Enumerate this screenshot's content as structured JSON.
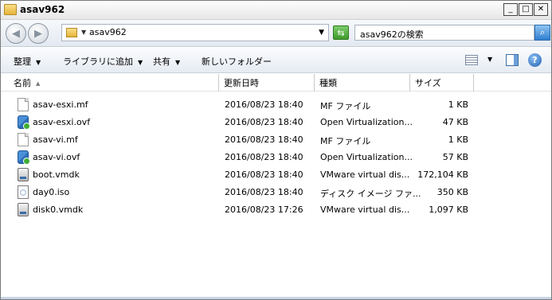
{
  "window": {
    "title": "asav962"
  },
  "address": {
    "path": "asav962"
  },
  "search": {
    "placeholder": "asav962の検索"
  },
  "toolbar": {
    "organize": "整理",
    "add_to_library": "ライブラリに追加",
    "share": "共有",
    "new_folder": "新しいフォルダー"
  },
  "columns": {
    "name": "名前",
    "date": "更新日時",
    "type": "種類",
    "size": "サイズ"
  },
  "files": [
    {
      "name": "asav-esxi.mf",
      "date": "2016/08/23 18:40",
      "type": "MF ファイル",
      "size": "1 KB",
      "icon": "document-icon"
    },
    {
      "name": "asav-esxi.ovf",
      "date": "2016/08/23 18:40",
      "type": "Open Virtualization...",
      "size": "47 KB",
      "icon": "ovf-icon"
    },
    {
      "name": "asav-vi.mf",
      "date": "2016/08/23 18:40",
      "type": "MF ファイル",
      "size": "1 KB",
      "icon": "document-icon"
    },
    {
      "name": "asav-vi.ovf",
      "date": "2016/08/23 18:40",
      "type": "Open Virtualization...",
      "size": "57 KB",
      "icon": "ovf-icon"
    },
    {
      "name": "boot.vmdk",
      "date": "2016/08/23 18:40",
      "type": "VMware virtual dis...",
      "size": "172,104 KB",
      "icon": "vmdk-icon"
    },
    {
      "name": "day0.iso",
      "date": "2016/08/23 18:40",
      "type": "ディスク イメージ ファ...",
      "size": "350 KB",
      "icon": "disc-image-icon"
    },
    {
      "name": "disk0.vmdk",
      "date": "2016/08/23 17:26",
      "type": "VMware virtual dis...",
      "size": "1,097 KB",
      "icon": "vmdk-icon"
    }
  ]
}
